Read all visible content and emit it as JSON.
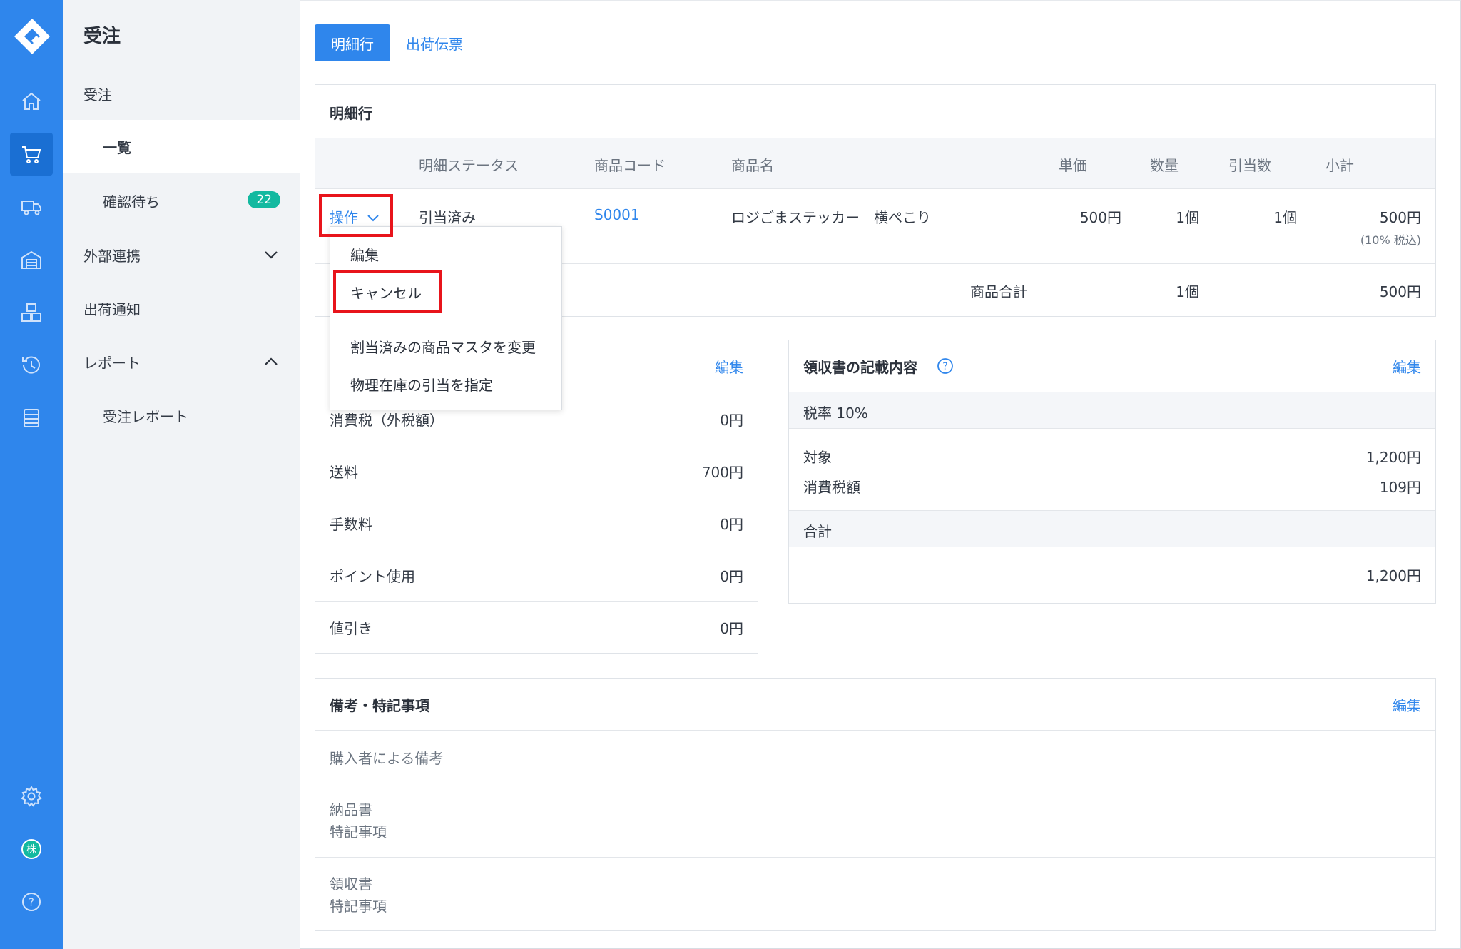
{
  "app": {
    "section_title": "受注"
  },
  "rail": {
    "icons": [
      "home-icon",
      "cart-icon",
      "truck-icon",
      "warehouse-icon",
      "boxes-icon",
      "history-icon",
      "list-icon",
      "gear-icon",
      "company-icon",
      "help-icon"
    ],
    "company_glyph": "株",
    "help_glyph": "?"
  },
  "sidebar": {
    "title": "受注",
    "items": [
      {
        "label": "受注"
      },
      {
        "label": "一覧"
      },
      {
        "label": "確認待ち",
        "badge": "22"
      },
      {
        "label": "外部連携"
      },
      {
        "label": "出荷通知"
      },
      {
        "label": "レポート"
      },
      {
        "label": "受注レポート"
      }
    ]
  },
  "tabs": [
    {
      "label": "明細行"
    },
    {
      "label": "出荷伝票"
    }
  ],
  "lines": {
    "title": "明細行",
    "columns": [
      "明細ステータス",
      "商品コード",
      "商品名",
      "単価",
      "数量",
      "引当数",
      "小計"
    ],
    "row": {
      "action": "操作",
      "status": "引当済み",
      "code": "S0001",
      "name": "ロジごまステッカー　横ぺこり",
      "price": "500円",
      "qty": "1個",
      "alloc": "1個",
      "subtotal": "500円",
      "tax_note": "(10% 税込)"
    },
    "total_label": "商品合計",
    "total_qty": "1個",
    "total_amount": "500円"
  },
  "dropdown": {
    "items": [
      "編集",
      "キャンセル",
      "割当済みの商品マスタを変更",
      "物理在庫の引当を指定"
    ]
  },
  "fees": {
    "edit": "編集",
    "rows": [
      {
        "label": "消費税（外税額）",
        "value": "0円"
      },
      {
        "label": "送料",
        "value": "700円"
      },
      {
        "label": "手数料",
        "value": "0円"
      },
      {
        "label": "ポイント使用",
        "value": "0円"
      },
      {
        "label": "値引き",
        "value": "0円"
      }
    ]
  },
  "receipt": {
    "title": "領収書の記載内容",
    "edit": "編集",
    "help": "?",
    "tax_rate": "税率 10%",
    "target_label": "対象",
    "target_value": "1,200円",
    "tax_label": "消費税額",
    "tax_value": "109円",
    "total_label": "合計",
    "total_value": "1,200円"
  },
  "notes": {
    "title": "備考・特記事項",
    "edit": "編集",
    "buyer": "購入者による備考",
    "delivery_1": "納品書",
    "delivery_2": "特記事項",
    "receipt_1": "領収書",
    "receipt_2": "特記事項"
  }
}
